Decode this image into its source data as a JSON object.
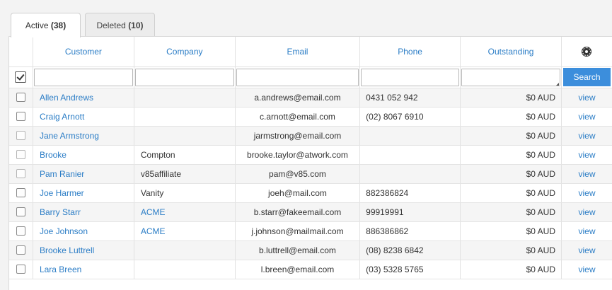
{
  "tabs": {
    "active": {
      "label": "Active",
      "count": "(38)"
    },
    "deleted": {
      "label": "Deleted",
      "count": "(10)"
    }
  },
  "columns": {
    "customer": "Customer",
    "company": "Company",
    "email": "Email",
    "phone": "Phone",
    "outstanding": "Outstanding"
  },
  "filter": {
    "search_label": "Search"
  },
  "rows": [
    {
      "customer": "Allen Andrews",
      "company": "",
      "company_link": false,
      "email": "a.andrews@email.com",
      "phone": "0431 052 942",
      "outstanding": "$0 AUD",
      "action": "view",
      "checkbox_dim": false
    },
    {
      "customer": "Craig Arnott",
      "company": "",
      "company_link": false,
      "email": "c.arnott@email.com",
      "phone": "(02) 8067 6910",
      "outstanding": "$0 AUD",
      "action": "view",
      "checkbox_dim": false
    },
    {
      "customer": "Jane Armstrong",
      "company": "",
      "company_link": false,
      "email": "jarmstrong@email.com",
      "phone": "",
      "outstanding": "$0 AUD",
      "action": "view",
      "checkbox_dim": true
    },
    {
      "customer": "Brooke",
      "company": "Compton",
      "company_link": false,
      "email": "brooke.taylor@atwork.com",
      "phone": "",
      "outstanding": "$0 AUD",
      "action": "view",
      "checkbox_dim": true
    },
    {
      "customer": "Pam Ranier",
      "company": "v85affiliate",
      "company_link": false,
      "email": "pam@v85.com",
      "phone": "",
      "outstanding": "$0 AUD",
      "action": "view",
      "checkbox_dim": true
    },
    {
      "customer": "Joe Harmer",
      "company": "Vanity",
      "company_link": false,
      "email": "joeh@mail.com",
      "phone": "882386824",
      "outstanding": "$0 AUD",
      "action": "view",
      "checkbox_dim": false
    },
    {
      "customer": "Barry Starr",
      "company": "ACME",
      "company_link": true,
      "email": "b.starr@fakeemail.com",
      "phone": "99919991",
      "outstanding": "$0 AUD",
      "action": "view",
      "checkbox_dim": false
    },
    {
      "customer": "Joe Johnson",
      "company": "ACME",
      "company_link": true,
      "email": "j.johnson@mailmail.com",
      "phone": "886386862",
      "outstanding": "$0 AUD",
      "action": "view",
      "checkbox_dim": false
    },
    {
      "customer": "Brooke Luttrell",
      "company": "",
      "company_link": false,
      "email": "b.luttrell@email.com",
      "phone": "(08) 8238 6842",
      "outstanding": "$0 AUD",
      "action": "view",
      "checkbox_dim": false
    },
    {
      "customer": "Lara Breen",
      "company": "",
      "company_link": false,
      "email": "l.breen@email.com",
      "phone": "(03) 5328 5765",
      "outstanding": "$0 AUD",
      "action": "view",
      "checkbox_dim": false
    }
  ],
  "colors": {
    "link": "#2b7dc6",
    "search_button": "#3c8edc"
  },
  "icons": {
    "settings": "gear-icon",
    "select_all": "checkbox-checked-icon"
  }
}
